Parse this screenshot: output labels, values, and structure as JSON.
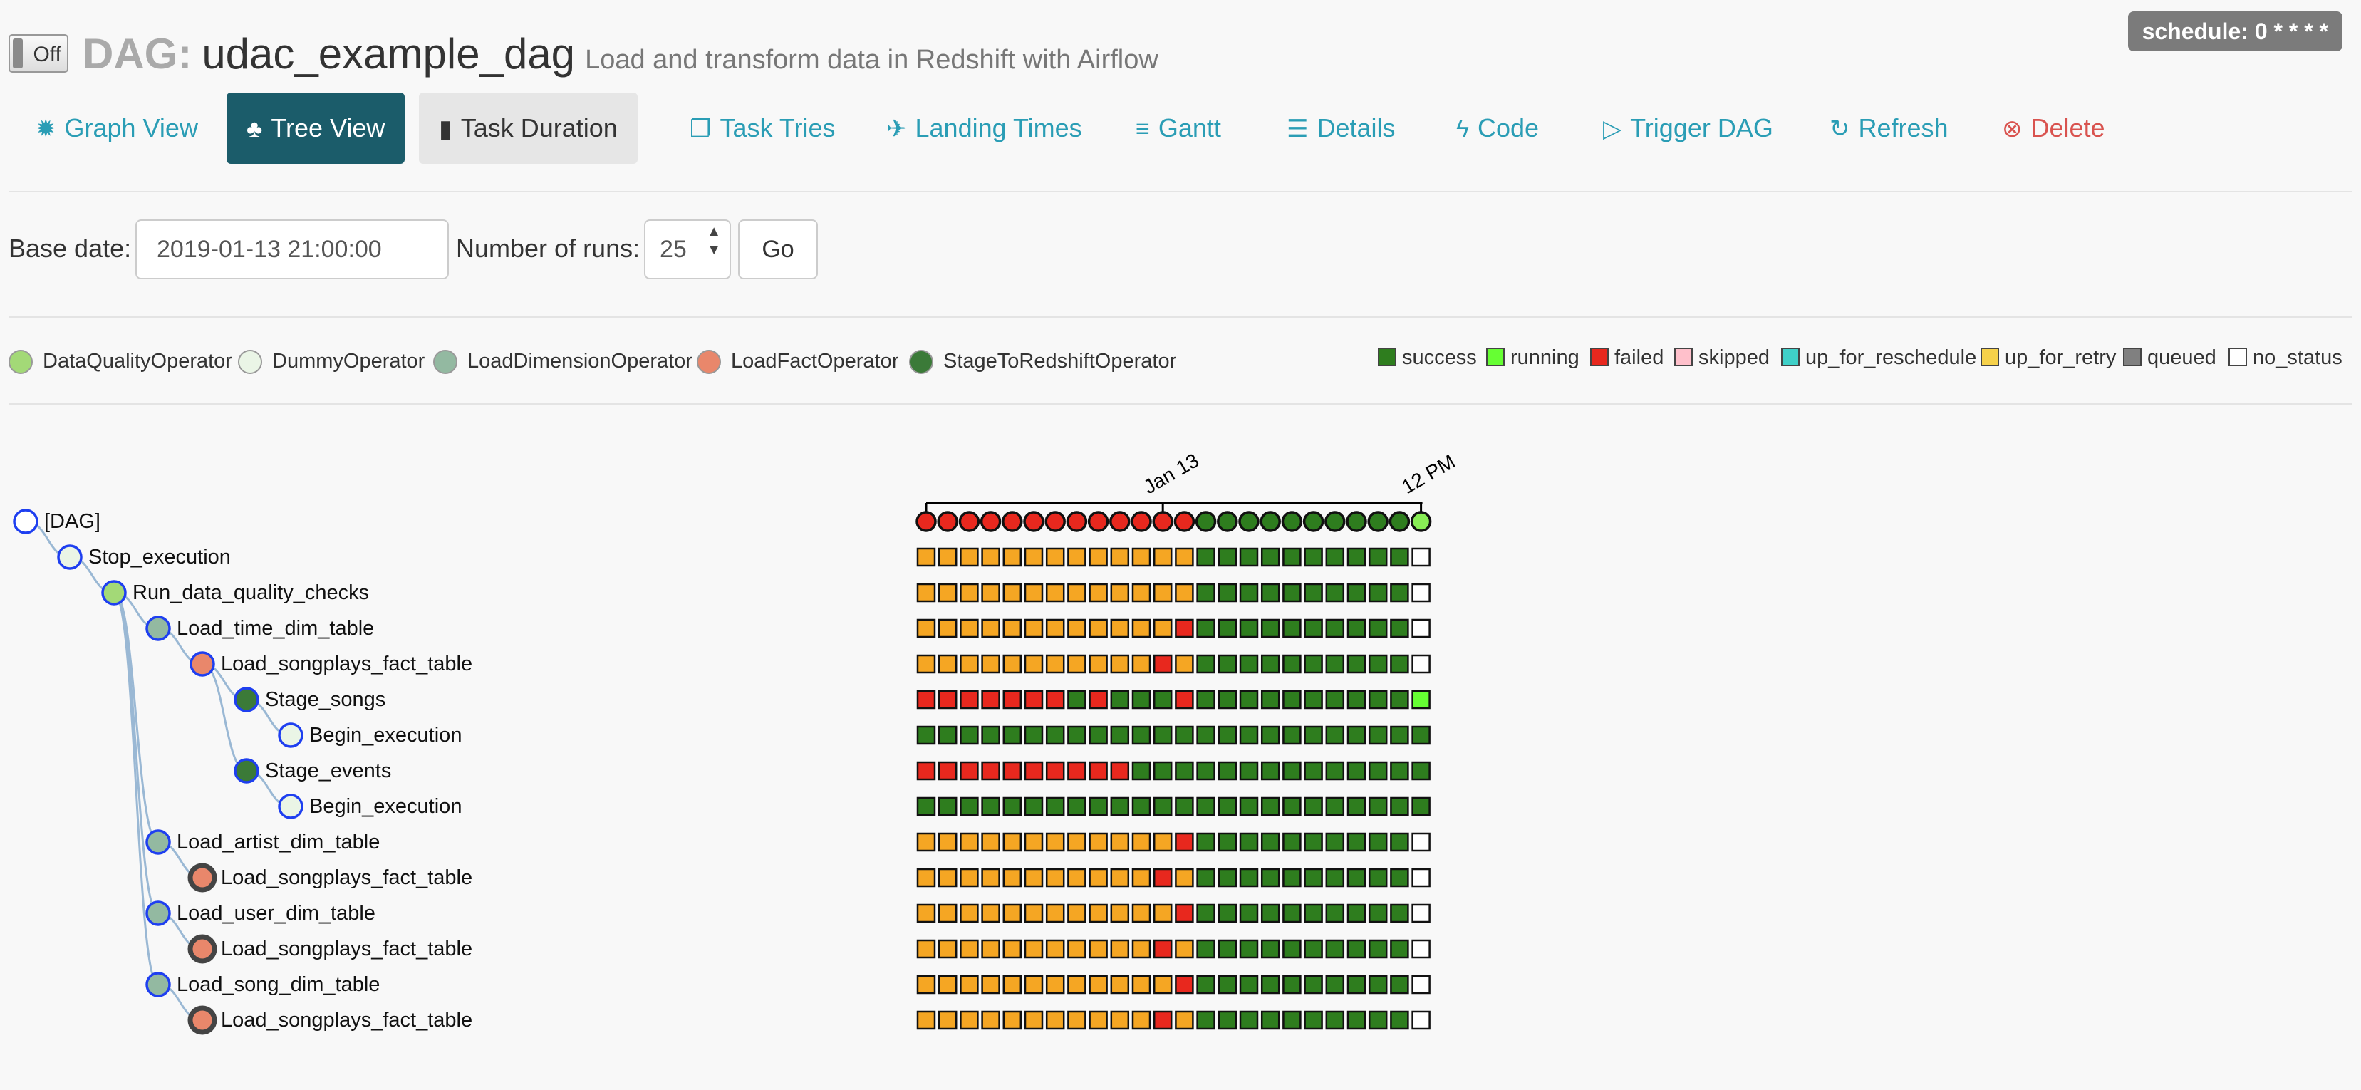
{
  "header": {
    "toggle_label": "Off",
    "dag_prefix": "DAG:",
    "dag_id": "udac_example_dag",
    "description": "Load and transform data in Redshift with Airflow",
    "schedule_badge": "schedule: 0 * * * *"
  },
  "nav": [
    {
      "label": "Graph View",
      "icon": "sun-icon",
      "glyph": "✹"
    },
    {
      "label": "Tree View",
      "icon": "tree-icon",
      "glyph": "♣"
    },
    {
      "label": "Task Duration",
      "icon": "bar-chart-icon",
      "glyph": "▮"
    },
    {
      "label": "Task Tries",
      "icon": "files-icon",
      "glyph": "❐"
    },
    {
      "label": "Landing Times",
      "icon": "plane-icon",
      "glyph": "✈"
    },
    {
      "label": "Gantt",
      "icon": "align-left-icon",
      "glyph": "≡"
    },
    {
      "label": "Details",
      "icon": "list-icon",
      "glyph": "☰"
    },
    {
      "label": "Code",
      "icon": "flash-icon",
      "glyph": "ϟ"
    },
    {
      "label": "Trigger DAG",
      "icon": "play-circle-icon",
      "glyph": "▷"
    },
    {
      "label": "Refresh",
      "icon": "refresh-icon",
      "glyph": "↻"
    },
    {
      "label": "Delete",
      "icon": "remove-circle-icon",
      "glyph": "⊗"
    }
  ],
  "form": {
    "base_date_label": "Base date:",
    "base_date_value": "2019-01-13 21:00:00",
    "num_runs_label": "Number of runs:",
    "num_runs_value": "25",
    "go_label": "Go"
  },
  "operators": [
    {
      "name": "DataQualityOperator",
      "color": "#a3d977"
    },
    {
      "name": "DummyOperator",
      "color": "#eaf5e6"
    },
    {
      "name": "LoadDimensionOperator",
      "color": "#93b9a1"
    },
    {
      "name": "LoadFactOperator",
      "color": "#e9876b"
    },
    {
      "name": "StageToRedshiftOperator",
      "color": "#3b7a38"
    }
  ],
  "states": [
    {
      "name": "success",
      "color": "#2e7d1e"
    },
    {
      "name": "running",
      "color": "#66ff33"
    },
    {
      "name": "failed",
      "color": "#e8281e"
    },
    {
      "name": "skipped",
      "color": "#ffc0cb"
    },
    {
      "name": "up_for_reschedule",
      "color": "#3fd0c8"
    },
    {
      "name": "up_for_retry",
      "color": "#f6d14a"
    },
    {
      "name": "queued",
      "color": "#808080"
    },
    {
      "name": "no_status",
      "color": "#ffffff"
    }
  ],
  "timeline": {
    "labels": [
      "Jan 13",
      "12 PM"
    ]
  },
  "tree": [
    {
      "label": "[DAG]",
      "operator": null,
      "row": "DAG"
    },
    {
      "label": "Stop_execution",
      "operator": "DummyOperator",
      "row": "A"
    },
    {
      "label": "Run_data_quality_checks",
      "operator": "DataQualityOperator",
      "row": "A"
    },
    {
      "label": "Load_time_dim_table",
      "operator": "LoadDimensionOperator",
      "row": "B"
    },
    {
      "label": "Load_songplays_fact_table",
      "operator": "LoadFactOperator",
      "row": "C"
    },
    {
      "label": "Stage_songs",
      "operator": "StageToRedshiftOperator",
      "row": "D"
    },
    {
      "label": "Begin_execution",
      "operator": "DummyOperator",
      "row": "F"
    },
    {
      "label": "Stage_events",
      "operator": "StageToRedshiftOperator",
      "row": "E"
    },
    {
      "label": "Begin_execution",
      "operator": "DummyOperator",
      "row": "F"
    },
    {
      "label": "Load_artist_dim_table",
      "operator": "LoadDimensionOperator",
      "row": "B"
    },
    {
      "label": "Load_songplays_fact_table",
      "operator": "LoadFactOperator",
      "row": "C",
      "collapsed": true
    },
    {
      "label": "Load_user_dim_table",
      "operator": "LoadDimensionOperator",
      "row": "B"
    },
    {
      "label": "Load_songplays_fact_table",
      "operator": "LoadFactOperator",
      "row": "C",
      "collapsed": true
    },
    {
      "label": "Load_song_dim_table",
      "operator": "LoadDimensionOperator",
      "row": "B"
    },
    {
      "label": "Load_songplays_fact_table",
      "operator": "LoadFactOperator",
      "row": "C",
      "collapsed": true
    }
  ],
  "run_rows": {
    "DAG": "FFFFFFFFFFFFFSSSSSSSSSSR",
    "A": "YYYYYYYYYYYYYSSSSSSSSSSN",
    "B": "YYYYYYYYYYYYFSSSSSSSSSSN",
    "C": "YYYYYYYYYYYFYSSSSSSSSSSN",
    "D": "FFFFFFFSFSSSFSSSSSSSSSSR",
    "E": "FFFFFFFFFFSSSSSSSSSSSSSS",
    "F": "SSSSSSSSSSSSSSSSSSSSSSSS"
  }
}
